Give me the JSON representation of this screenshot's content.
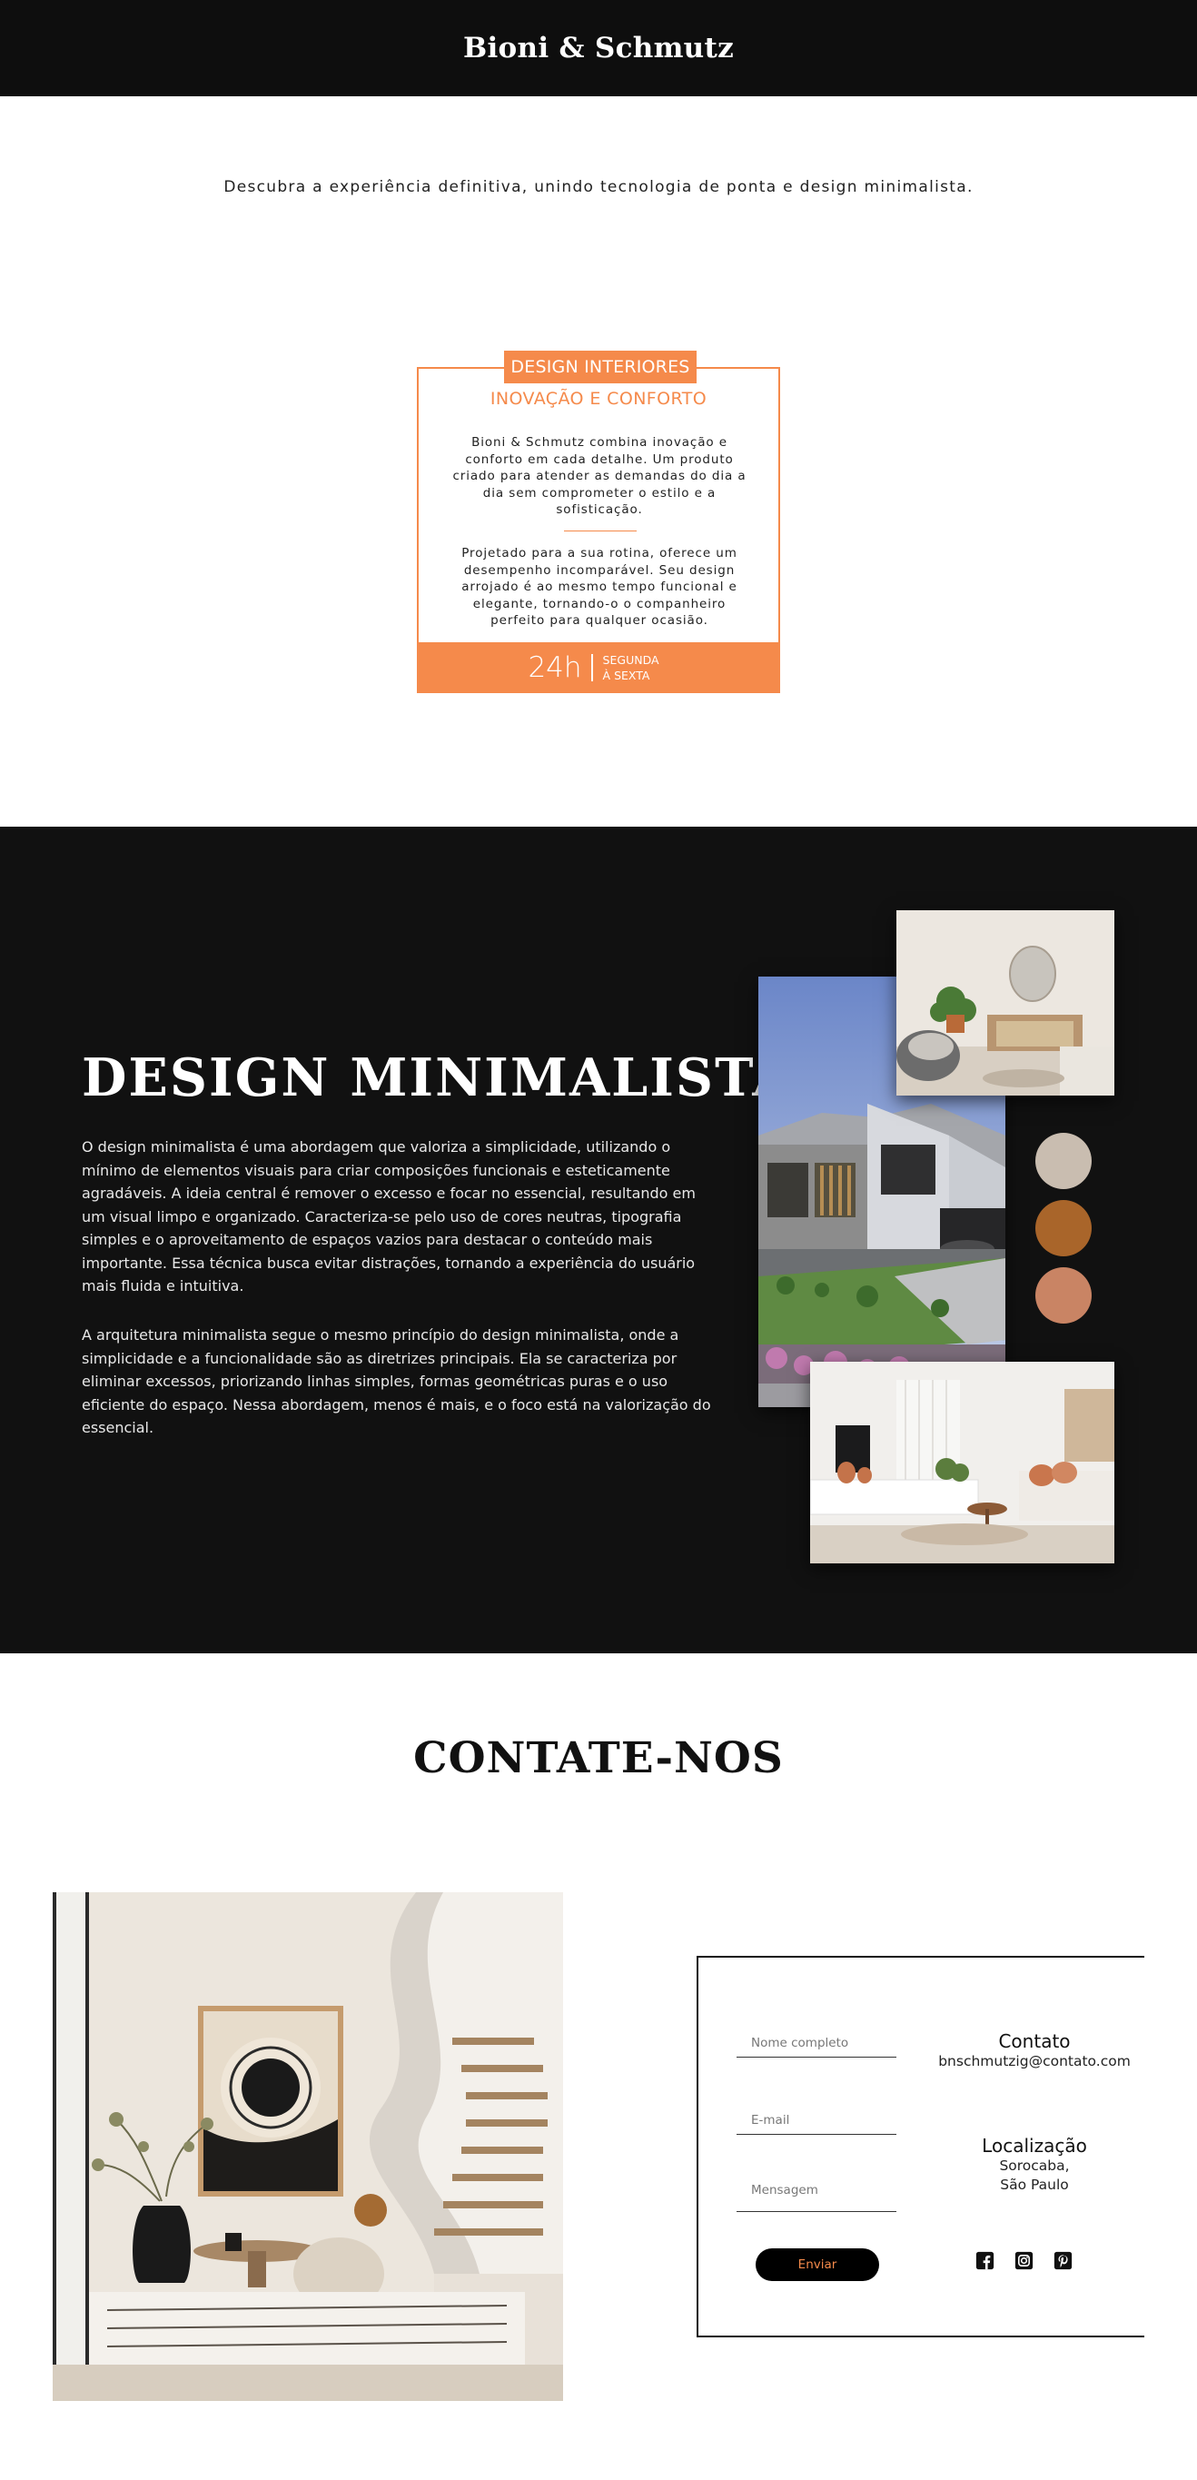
{
  "header": {
    "brand": "Bioni & Schmutz"
  },
  "hero": {
    "tagline": "Descubra a experiência definitiva, unindo tecnologia de ponta e design minimalista."
  },
  "card": {
    "label": "DESIGN INTERIORES",
    "subtitle": "INOVAÇÃO E CONFORTO",
    "paragraph1": "Bioni & Schmutz combina inovação e conforto em cada detalhe. Um produto criado para atender as demandas do dia a dia sem comprometer o estilo e a sofisticação.",
    "paragraph2": "Projetado para a sua rotina, oferece um desempenho incomparável. Seu design arrojado é ao mesmo tempo funcional e elegante, tornando-o o companheiro perfeito para qualquer ocasião.",
    "hours": "24h",
    "days": "SEGUNDA À SEXTA",
    "accent": "#f58a4b"
  },
  "minimal": {
    "title": "DESIGN MINIMALISTA",
    "paragraph1": "O design minimalista é uma abordagem que valoriza a simplicidade, utilizando o mínimo de elementos visuais para criar composições funcionais e esteticamente agradáveis. A ideia central é remover o excesso e focar no essencial, resultando em um visual limpo e organizado. Caracteriza-se pelo uso de cores neutras, tipografia simples e o aproveitamento de espaços vazios para destacar o conteúdo mais importante. Essa técnica busca evitar distrações, tornando a experiência do usuário mais fluida e intuitiva.",
    "paragraph2": "A arquitetura minimalista segue o mesmo princípio do design minimalista, onde a simplicidade e a funcionalidade são as diretrizes principais. Ela se caracteriza por eliminar excessos, priorizando linhas simples, formas geométricas puras e o uso eficiente do espaço. Nessa abordagem, menos é mais, e o foco está na valorização do essencial.",
    "palette": [
      "#c9bdb0",
      "#a9652a",
      "#c98464"
    ]
  },
  "contact": {
    "title": "CONTATE-NOS",
    "form": {
      "name_placeholder": "Nome completo",
      "email_placeholder": "E-mail",
      "message_placeholder": "Mensagem",
      "send_label": "Enviar"
    },
    "info": {
      "contact_heading": "Contato",
      "email": "bnschmutzig@contato.com",
      "location_heading": "Localização",
      "city": "Sorocaba,",
      "state": "São Paulo"
    },
    "socials": [
      "facebook-icon",
      "instagram-icon",
      "pinterest-icon"
    ]
  }
}
